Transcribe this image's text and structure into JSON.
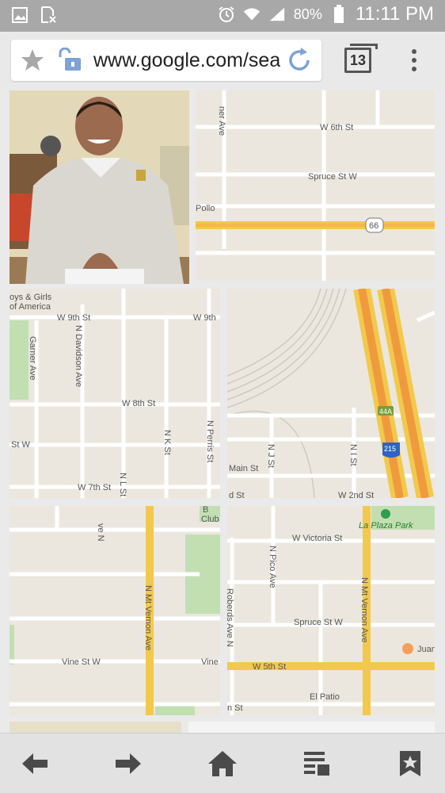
{
  "status_bar": {
    "battery": "80%",
    "time": "11:11 PM"
  },
  "browser": {
    "url": "www.google.com/search",
    "tab_count": "13"
  },
  "map": {
    "tile_top": {
      "streets": [
        "W 6th St",
        "Spruce St W",
        "Pollo",
        "66",
        "ner Ave"
      ]
    },
    "tile_mid_left": {
      "streets": [
        "oys & Girls",
        "of America",
        "W 9th St",
        "W 9th",
        "Garner Ave",
        "N Davidson Ave",
        "W 8th St",
        "N K St",
        "N Perris St",
        "St W",
        "W 7th St",
        "N L St"
      ]
    },
    "tile_mid_right": {
      "streets": [
        "N J St",
        "N I St",
        "Main St",
        "d St",
        "W 2nd St",
        "44A",
        "215"
      ]
    },
    "tile_bottom_left": {
      "streets": [
        "ve N",
        "Club",
        "N Mt Vernon Ave",
        "Vine St W",
        "Vine",
        "B"
      ]
    },
    "tile_bottom_right": {
      "streets": [
        "La Plaza Park",
        "W Victoria St",
        "N Pico Ave",
        "Roberds Ave N",
        "Spruce St W",
        "N Mt Vernon Ave",
        "W 5th St",
        "El Patio",
        "Juan",
        "n St"
      ]
    }
  }
}
